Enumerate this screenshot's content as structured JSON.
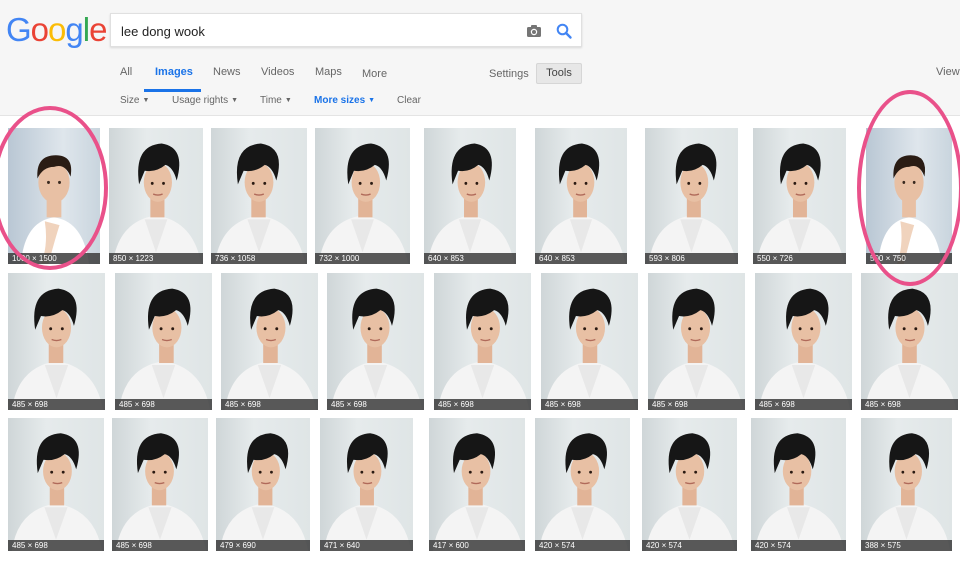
{
  "logo": {
    "letters": [
      "G",
      "o",
      "o",
      "g",
      "l",
      "e"
    ],
    "colors": [
      "#4285f4",
      "#ea4335",
      "#fbbc05",
      "#4285f4",
      "#34a853",
      "#ea4335"
    ]
  },
  "search": {
    "query": "lee dong wook"
  },
  "tabs": [
    {
      "label": "All",
      "active": false
    },
    {
      "label": "Images",
      "active": true
    },
    {
      "label": "News",
      "active": false
    },
    {
      "label": "Videos",
      "active": false
    },
    {
      "label": "Maps",
      "active": false
    },
    {
      "label": "More",
      "active": false
    }
  ],
  "settings_label": "Settings",
  "tools_label": "Tools",
  "view_label": "View",
  "tools": [
    {
      "label": "Size",
      "dropdown": true
    },
    {
      "label": "Usage rights",
      "dropdown": true
    },
    {
      "label": "Time",
      "dropdown": true
    },
    {
      "label": "More sizes",
      "dropdown": true
    },
    {
      "label": "Clear",
      "dropdown": false
    }
  ],
  "rows": [
    [
      "1000 × 1500",
      "850 × 1223",
      "736 × 1058",
      "732 × 1000",
      "640 × 853",
      "640 × 853",
      "593 × 806",
      "550 × 726",
      "500 × 750"
    ],
    [
      "485 × 698",
      "485 × 698",
      "485 × 698",
      "485 × 698",
      "485 × 698",
      "485 × 698",
      "485 × 698",
      "485 × 698",
      "485 × 698"
    ],
    [
      "485 × 698",
      "485 × 698",
      "479 × 690",
      "471 × 640",
      "417 × 600",
      "420 × 574",
      "420 × 574",
      "420 × 574",
      "388 × 575"
    ]
  ],
  "colors": {
    "accent": "#1a73e8",
    "highlight_ring": "#e9518a",
    "hair": "#161616",
    "skin": "#e8c0a4",
    "shirt": "#f4f4f4"
  }
}
